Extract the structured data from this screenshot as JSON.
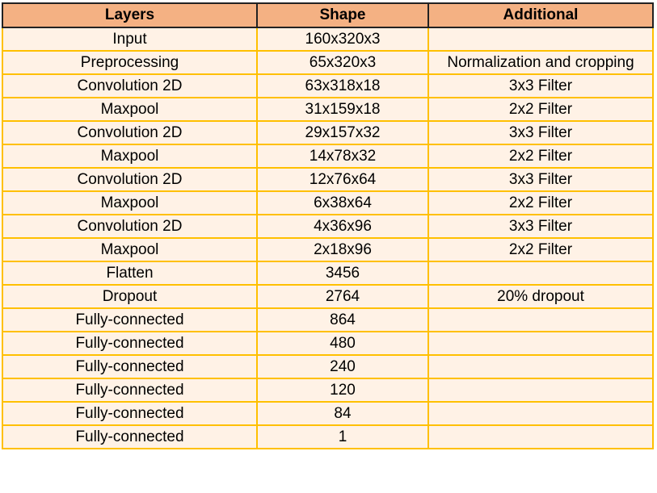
{
  "table": {
    "headers": [
      "Layers",
      "Shape",
      "Additional"
    ],
    "rows": [
      [
        "Input",
        "160x320x3",
        ""
      ],
      [
        "Preprocessing",
        "65x320x3",
        "Normalization and cropping"
      ],
      [
        "Convolution 2D",
        "63x318x18",
        "3x3 Filter"
      ],
      [
        "Maxpool",
        "31x159x18",
        "2x2 Filter"
      ],
      [
        "Convolution 2D",
        "29x157x32",
        "3x3 Filter"
      ],
      [
        "Maxpool",
        "14x78x32",
        "2x2 Filter"
      ],
      [
        "Convolution 2D",
        "12x76x64",
        "3x3 Filter"
      ],
      [
        "Maxpool",
        "6x38x64",
        "2x2 Filter"
      ],
      [
        "Convolution 2D",
        "4x36x96",
        "3x3 Filter"
      ],
      [
        "Maxpool",
        "2x18x96",
        "2x2 Filter"
      ],
      [
        "Flatten",
        "3456",
        ""
      ],
      [
        "Dropout",
        "2764",
        "20% dropout"
      ],
      [
        "Fully-connected",
        "864",
        ""
      ],
      [
        "Fully-connected",
        "480",
        ""
      ],
      [
        "Fully-connected",
        "240",
        ""
      ],
      [
        "Fully-connected",
        "120",
        ""
      ],
      [
        "Fully-connected",
        "84",
        ""
      ],
      [
        "Fully-connected",
        "1",
        ""
      ]
    ]
  },
  "colors": {
    "header_background": "#f4b183",
    "header_border": "#222222",
    "cell_background": "#fff2e6",
    "cell_border": "#ffc000"
  }
}
